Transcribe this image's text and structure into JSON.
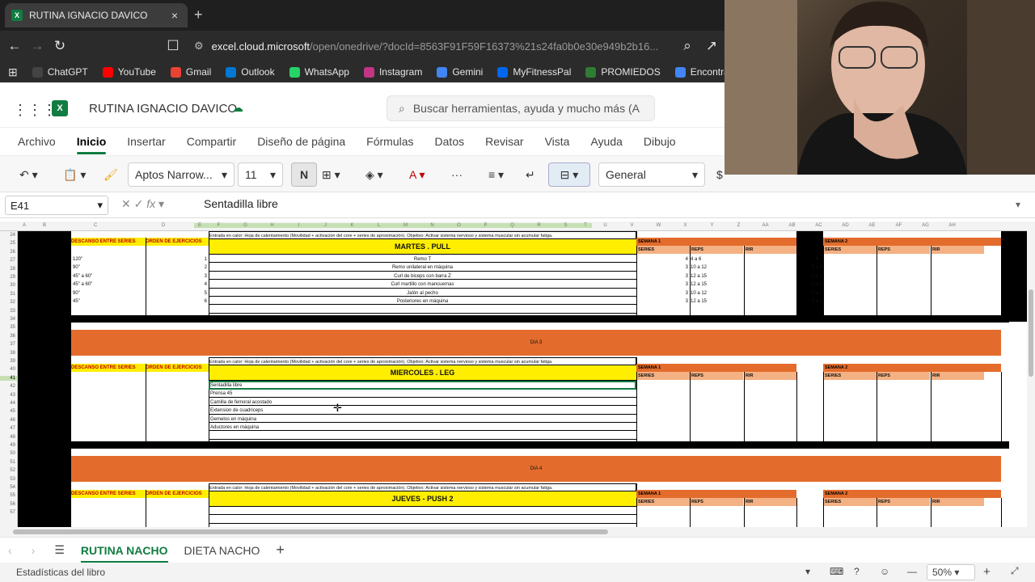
{
  "browser": {
    "tab_title": "RUTINA IGNACIO DAVICO",
    "tab_close": "×",
    "new_tab": "+",
    "url_host": "excel.cloud.microsoft",
    "url_path": "/open/onedrive/?docId=8563F91F59F16373%21s24fa0b0e30e949b2b16...",
    "bookmarks": [
      "ChatGPT",
      "YouTube",
      "Gmail",
      "Outlook",
      "WhatsApp",
      "Instagram",
      "Gemini",
      "MyFitnessPal",
      "PROMIEDOS",
      "Encontrar mi dis"
    ],
    "bookmark_colors": [
      "#444444",
      "#ff0000",
      "#ea4335",
      "#0078d4",
      "#25d366",
      "#c13584",
      "#4285f4",
      "#0066ee",
      "#2e7d32",
      "#4285f4"
    ]
  },
  "excel": {
    "doc_title": "RUTINA IGNACIO DAVICO",
    "search_placeholder": "Buscar herramientas, ayuda y mucho más (A",
    "menus": [
      "Archivo",
      "Inicio",
      "Insertar",
      "Compartir",
      "Diseño de página",
      "Fórmulas",
      "Datos",
      "Revisar",
      "Vista",
      "Ayuda",
      "Dibujo"
    ],
    "active_menu": "Inicio",
    "font_name": "Aptos Narrow...",
    "font_size": "11",
    "bold_label": "N",
    "number_format": "General",
    "name_box": "E41",
    "formula": "Sentadilla libre",
    "accent": "#107c41"
  },
  "grid": {
    "columns": [
      "A",
      "B",
      "C",
      "D",
      "E",
      "F",
      "G",
      "H",
      "I",
      "J",
      "K",
      "L",
      "M",
      "N",
      "O",
      "P",
      "Q",
      "R",
      "S",
      "T",
      "U",
      "V",
      "W",
      "X",
      "Y",
      "Z",
      "AA",
      "AB",
      "AC",
      "AD",
      "AE",
      "AF",
      "AG",
      "AH"
    ],
    "rows": [
      "24",
      "25",
      "26",
      "27",
      "28",
      "29",
      "30",
      "31",
      "32",
      "33",
      "34",
      "35",
      "36",
      "37",
      "38",
      "39",
      "40",
      "41",
      "42",
      "43",
      "44",
      "45",
      "46",
      "47",
      "48",
      "49",
      "50",
      "51",
      "52",
      "53",
      "54",
      "55",
      "56",
      "57"
    ],
    "descanso_label": "DESCANSO ENTRE SERIES",
    "orden_label": "ORDEN DE EJERCICIOS",
    "warmup": "Entrada en calor: Hoja de calentamiento (Movilidad + activación del core + series de aproximación). Objetivo: Activar sistema nervioso y sistema muscular sin acumular fatiga.",
    "semana1": "SEMANA 1",
    "semana2": "SEMANA 2",
    "series_h": "SERIES",
    "reps_h": "REPS",
    "rir_h": "RIR",
    "pull": {
      "title": "MARTES . PULL",
      "descansos": [
        "120\"",
        "90\"",
        "45\" a 60\"",
        "45\" a 60\"",
        "90\"",
        "45\""
      ],
      "orden": [
        "1",
        "2",
        "3",
        "4",
        "5",
        "6"
      ],
      "exercises": [
        "Remo T",
        "Remo unilateral en máquina",
        "Curl de biceps con barra Z",
        "Curl martillo con mancuernas",
        "Jalón al pecho",
        "Posteriores en máquina"
      ],
      "series": [
        "4",
        "3",
        "3",
        "3",
        "3",
        "3"
      ],
      "reps": [
        "4 a 6",
        "10 a 12",
        "12 a 15",
        "12 a 15",
        "10 a 12",
        "12 a 15"
      ],
      "rir": [
        "4",
        "3 a 2",
        "2 a 1",
        "1 a 0",
        "2 a 2",
        "2 a 1"
      ]
    },
    "dia3": "DIA 3",
    "leg": {
      "title": "MIERCOLES . LEG",
      "exercises": [
        "Sentadilla libre",
        "Prensa 45",
        "Camilla de femoral acostado",
        "Extension de cuadriceps",
        "Gemelos en máquina",
        "Aductores en máquina"
      ]
    },
    "dia4": "DIA 4",
    "push": {
      "title": "JUEVES - PUSH 2"
    }
  },
  "sheets": {
    "tabs": [
      "RUTINA NACHO",
      "DIETA NACHO"
    ],
    "active": "RUTINA NACHO",
    "add": "+"
  },
  "status": {
    "left": "Estadísticas del libro",
    "zoom": "50%",
    "minus": "—",
    "plus": "+"
  }
}
